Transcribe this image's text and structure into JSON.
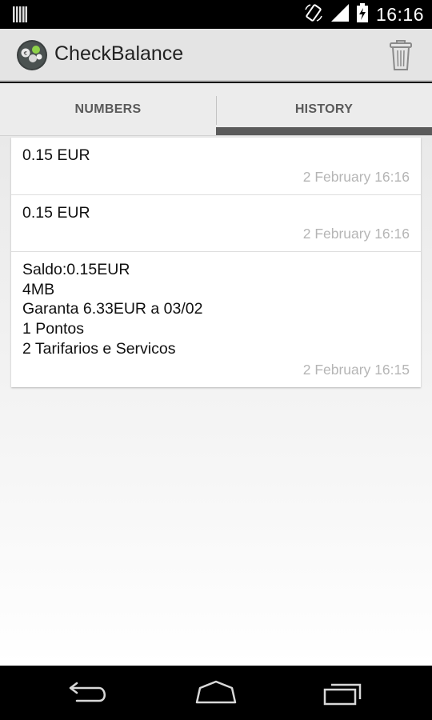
{
  "status_bar": {
    "time": "16:16",
    "icons": [
      "notification-bars-icon",
      "rotation-icon",
      "signal-icon",
      "battery-charging-icon"
    ]
  },
  "action_bar": {
    "title": "CheckBalance",
    "app_icon": "checkbalance-app-icon",
    "action_icon": "trash-icon"
  },
  "tabs": [
    {
      "label": "NUMBERS",
      "selected": false
    },
    {
      "label": "HISTORY",
      "selected": true
    }
  ],
  "history": [
    {
      "text": "0.15 EUR",
      "date": "2 February 16:16"
    },
    {
      "text": "0.15 EUR",
      "date": "2 February 16:16"
    },
    {
      "text": "Saldo:0.15EUR\n4MB\nGaranta 6.33EUR a 03/02\n1 Pontos\n2 Tarifarios e Servicos",
      "date": "2 February 16:15"
    }
  ],
  "nav_bar": {
    "icons": [
      "back-icon",
      "home-icon",
      "recent-apps-icon"
    ]
  },
  "colors": {
    "status_bar": "#000000",
    "action_bar": "#e4e4e4",
    "tab_indicator": "#5b5b5b",
    "date_text": "#b5b5b5"
  }
}
